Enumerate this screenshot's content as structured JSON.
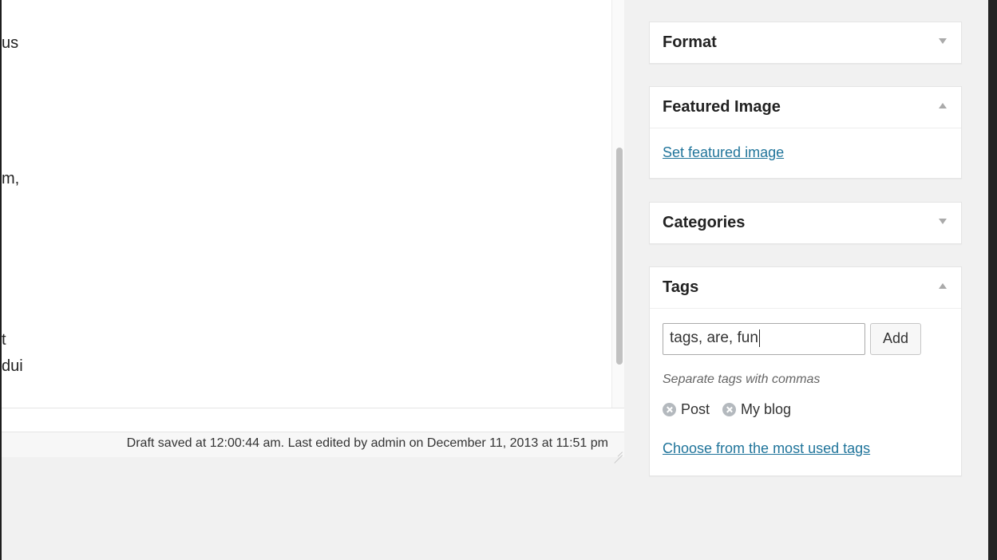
{
  "editor": {
    "text_fragments": [
      "us",
      "m,",
      "t",
      "dui"
    ],
    "status": "Draft saved at 12:00:44 am. Last edited by admin on December 11, 2013 at 11:51 pm"
  },
  "sidebar": {
    "format": {
      "title": "Format",
      "state": "collapsed"
    },
    "featured_image": {
      "title": "Featured Image",
      "state": "expanded",
      "link": "Set featured image"
    },
    "categories": {
      "title": "Categories",
      "state": "collapsed"
    },
    "tags": {
      "title": "Tags",
      "state": "expanded",
      "input_value": "tags, are, fun",
      "add_label": "Add",
      "hint": "Separate tags with commas",
      "items": [
        "Post",
        "My blog"
      ],
      "most_used_link": "Choose from the most used tags"
    }
  },
  "colors": {
    "link": "#21759b",
    "background": "#f1f1f1",
    "panel": "#ffffff"
  }
}
